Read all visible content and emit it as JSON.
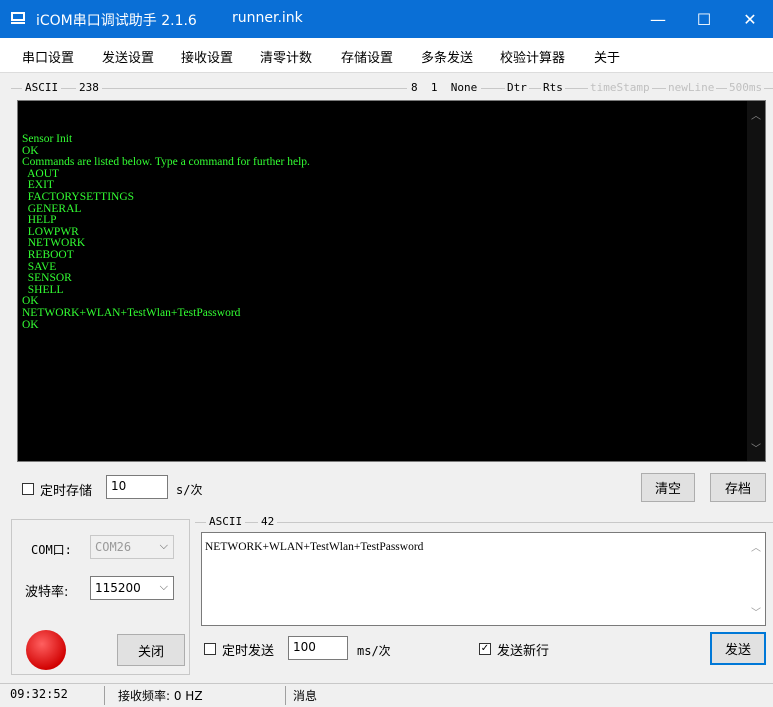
{
  "window": {
    "title": "iCOM串口调试助手 2.1.6",
    "subtitle": "runner.ink",
    "minimize": "—",
    "maximize": "☐",
    "close": "✕"
  },
  "menu": [
    "串口设置",
    "发送设置",
    "接收设置",
    "清零计数",
    "存储设置",
    "多条发送",
    "校验计算器",
    "关于"
  ],
  "receive": {
    "mode": "ASCII",
    "count": "238",
    "databits": "8",
    "stopbits": "1",
    "parity": "None",
    "dtr": "Dtr",
    "rts": "Rts",
    "timestamp": "timeStamp",
    "newline": "newLine",
    "interval": "500ms",
    "text": "Sensor Init\nOK\nCommands are listed below. Type a command for further help.\n  AOUT\n  EXIT\n  FACTORYSETTINGS\n  GENERAL\n  HELP\n  LOWPWR\n  NETWORK\n  REBOOT\n  SAVE\n  SENSOR\n  SHELL\nOK\nNETWORK+WLAN+TestWlan+TestPassword\nOK"
  },
  "timed_save": {
    "label": "定时存储",
    "value": "10",
    "unit": "s/次",
    "checked": false
  },
  "buttons": {
    "clear": "清空",
    "save": "存档",
    "close_port": "关闭",
    "send": "发送"
  },
  "port": {
    "com_label": "COM口:",
    "com_value": "COM26",
    "baud_label": "波特率:",
    "baud_value": "115200",
    "status_color": "#e00000"
  },
  "send": {
    "mode": "ASCII",
    "count": "42",
    "text": "NETWORK+WLAN+TestWlan+TestPassword",
    "timed_label": "定时发送",
    "timed_checked": false,
    "timed_value": "100",
    "timed_unit": "ms/次",
    "newline_label": "发送新行",
    "newline_checked": true
  },
  "status": {
    "time": "09:32:52",
    "freq": "接收频率: 0 HZ",
    "message": "消息"
  }
}
